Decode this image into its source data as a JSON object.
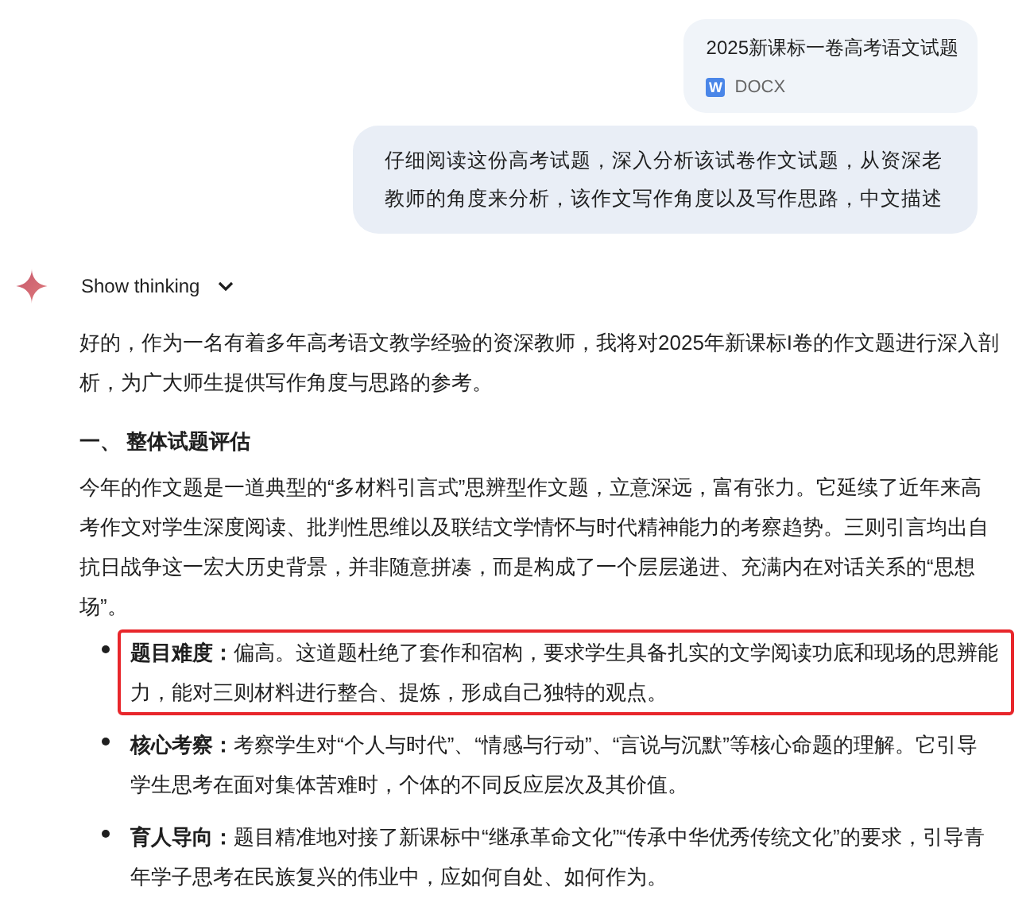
{
  "attachment": {
    "title": "2025新课标一卷高考语文试题",
    "file_type": "DOCX",
    "type_icon": "W"
  },
  "user_message": "仔细阅读这份高考试题，深入分析该试卷作文试题，从资深老教师的角度来分析，该作文写作角度以及写作思路，中文描述",
  "thinking": {
    "label": "Show thinking",
    "expanded": false
  },
  "response": {
    "intro": "好的，作为一名有着多年高考语文教学经验的资深教师，我将对2025年新课标I卷的作文题进行深入剖析，为广大师生提供写作角度与思路的参考。",
    "section_heading": "一、 整体试题评估",
    "paragraph": "今年的作文题是一道典型的“多材料引言式”思辨型作文题，立意深远，富有张力。它延续了近年来高考作文对学生深度阅读、批判性思维以及联结文学情怀与时代精神能力的考察趋势。三则引言均出自抗日战争这一宏大历史背景，并非随意拼凑，而是构成了一个层层递进、充满内在对话关系的“思想场”。",
    "bullets": [
      {
        "text": "**题目难度：**偏高。这道题杜绝了套作和宿构，要求学生具备扎实的文学阅读功底和现场的思辨能力，能对三则材料进行整合、提炼，形成自己独特的观点。",
        "highlighted": true
      },
      {
        "text": "**核心考察：**考察学生对“个人与时代”、“情感与行动”、“言说与沉默”等核心命题的理解。它引导学生思考在面对集体苦难时，个体的不同反应层次及其价值。",
        "highlighted": false
      },
      {
        "text": "**育人导向：**题目精准地对接了新课标中“继承革命文化”“传承中华优秀传统文化”的要求，引导青年学子思考在民族复兴的伟业中，应如何自处、如何作为。",
        "highlighted": false
      }
    ]
  }
}
